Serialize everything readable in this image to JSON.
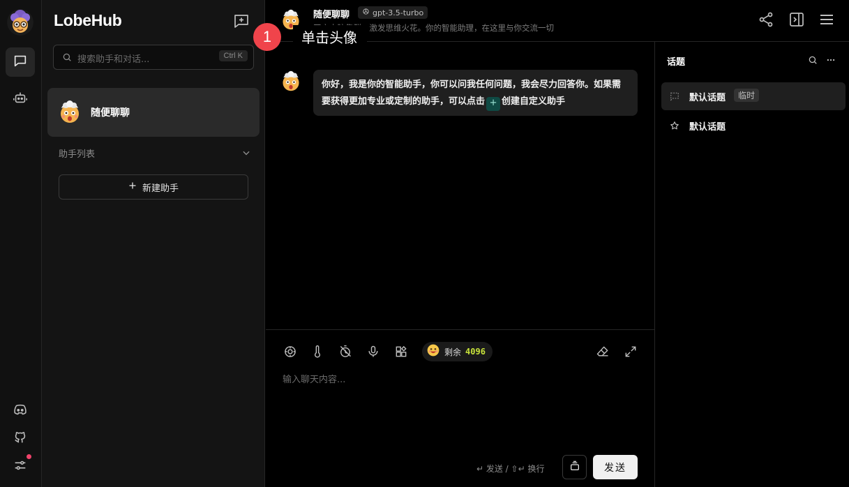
{
  "rail": {
    "items": [
      "user-avatar",
      "chat-icon",
      "robot-icon"
    ],
    "bottom_items": [
      "discord-icon",
      "github-icon",
      "settings-icon"
    ],
    "settings_badge_color": "#f0436b"
  },
  "sessions": {
    "logo": "LobeHub",
    "search_placeholder": "搜索助手和对话...",
    "search_shortcut": "Ctrl K",
    "active_session": "随便聊聊",
    "list_label": "助手列表",
    "new_assistant": "新建助手"
  },
  "header": {
    "title": "随便聊聊",
    "model": "gpt-3.5-turbo",
    "description": "开启大脑集群，激发思维火花。你的智能助理，在这里与你交流一切"
  },
  "annotation": {
    "number": "1",
    "label": "单击头像",
    "color": "#f0444b"
  },
  "chat": {
    "message_part1": "你好，我是你的智能助手，你可以问我任何问题，我会尽力回答你。如果需要获得更加专业或定制的助手，可以点击",
    "message_plus": "+",
    "message_part2": "创建自定义助手"
  },
  "input": {
    "token_label": "剩余",
    "token_count": "4096",
    "placeholder": "输入聊天内容...",
    "hint": "↵ 发送 / ⇧↵ 换行",
    "send_label": "发送"
  },
  "topics": {
    "title": "话题",
    "items": [
      {
        "name": "默认话题",
        "tag": "临时"
      },
      {
        "name": "默认话题"
      }
    ]
  }
}
